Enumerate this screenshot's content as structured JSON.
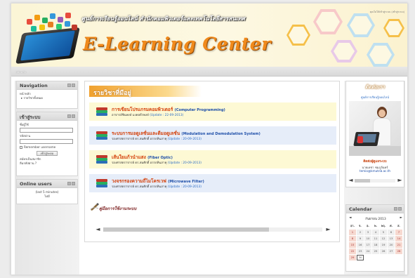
{
  "banner": {
    "thai_title": "ศูนย์การเรียนรู้ออนไลน์ สำนักคอมพิวเตอร์และเทคโนโลยีสารสนเทศ",
    "title": "E-Learning Center",
    "login_info": "คุณไม่ได้เข้าสู่ระบบ (เข้าสู่ระบบ)"
  },
  "navbar": {
    "label": "หน้าหลัก"
  },
  "navigation": {
    "title": "Navigation",
    "items": [
      "หน้าหลัก",
      "รายวิชาทั้งหมด"
    ]
  },
  "login": {
    "title": "เข้าสู่ระบบ",
    "username_label": "ชื่อผู้ใช้",
    "password_label": "รหัสผ่าน",
    "remember_label": "Remember username",
    "button": "เข้าสู่ระบบ",
    "signup": "สมัครเป็นสมาชิก",
    "forgot": "ลืมรหัสผ่าน ?"
  },
  "online_users": {
    "title": "Online users",
    "period": "(last 5 minutes)",
    "none": "ไม่มี"
  },
  "main": {
    "heading": "รายวิชาที่มีอยู่",
    "courses": [
      {
        "title_th": "การเขียนโปรแกรมคอมพิวเตอร์",
        "title_en": "(Computer Programming)",
        "teacher": "อาจารย์ชินพงษ์ มงคลธีรพงษ์",
        "update": "(Update : 22-09-2013)"
      },
      {
        "title_th": "ระบบการมอดูเลชั่นและดีมอดูเลชั่น",
        "title_en": "(Modulation and Demodulation System)",
        "teacher": "รองศาสตราจารย์ ดร.สมศักดิ์ อรรถทินภาคุ",
        "update": "(Update : 20-09-2013)"
      },
      {
        "title_th": "เส้นใยแก้วนำแสง",
        "title_en": "(Fiber Optic)",
        "teacher": "รองศาสตราจารย์ ดร.สมศักดิ์ อรรถทินภาคุ",
        "update": "(Update : 20-09-2013)"
      },
      {
        "title_th": "วงจรกรองความถี่ไมโครเวฟ",
        "title_en": "(Microwave Filter)",
        "teacher": "รองศาสตราจารย์ ดร.สมศักดิ์ อรรถทินภาคุ",
        "update": "(Update : 20-09-2013)"
      }
    ],
    "manual_link": "คู่มือการใช้งานระบบ"
  },
  "contact": {
    "title": "ติดต่อเรา",
    "subtitle": "ศูนย์การเรียนรู้ออนไลน์",
    "head2": "ติดต่อผู้ดูแลระบบ",
    "name": "นายเดชา ชมภูจันทร์",
    "email": "temio@kmutnb.ac.th"
  },
  "calendar": {
    "title": "Calendar",
    "month": "กันยายน 2013",
    "prev": "◄",
    "next": "►",
    "days": [
      "อา.",
      "จ.",
      "อ.",
      "พ.",
      "พฤ.",
      "ศ.",
      "ส."
    ],
    "weeks": [
      [
        "1",
        "2",
        "3",
        "4",
        "5",
        "6",
        "7"
      ],
      [
        "8",
        "9",
        "10",
        "11",
        "12",
        "13",
        "14"
      ],
      [
        "15",
        "16",
        "17",
        "18",
        "19",
        "20",
        "21"
      ],
      [
        "22",
        "23",
        "24",
        "25",
        "26",
        "27",
        "28"
      ],
      [
        "29",
        "30",
        "",
        "",
        "",
        "",
        ""
      ]
    ],
    "today": "30"
  },
  "icons": {
    "scroll_left": "◄",
    "scroll_right": "►",
    "bullet": "▸"
  }
}
